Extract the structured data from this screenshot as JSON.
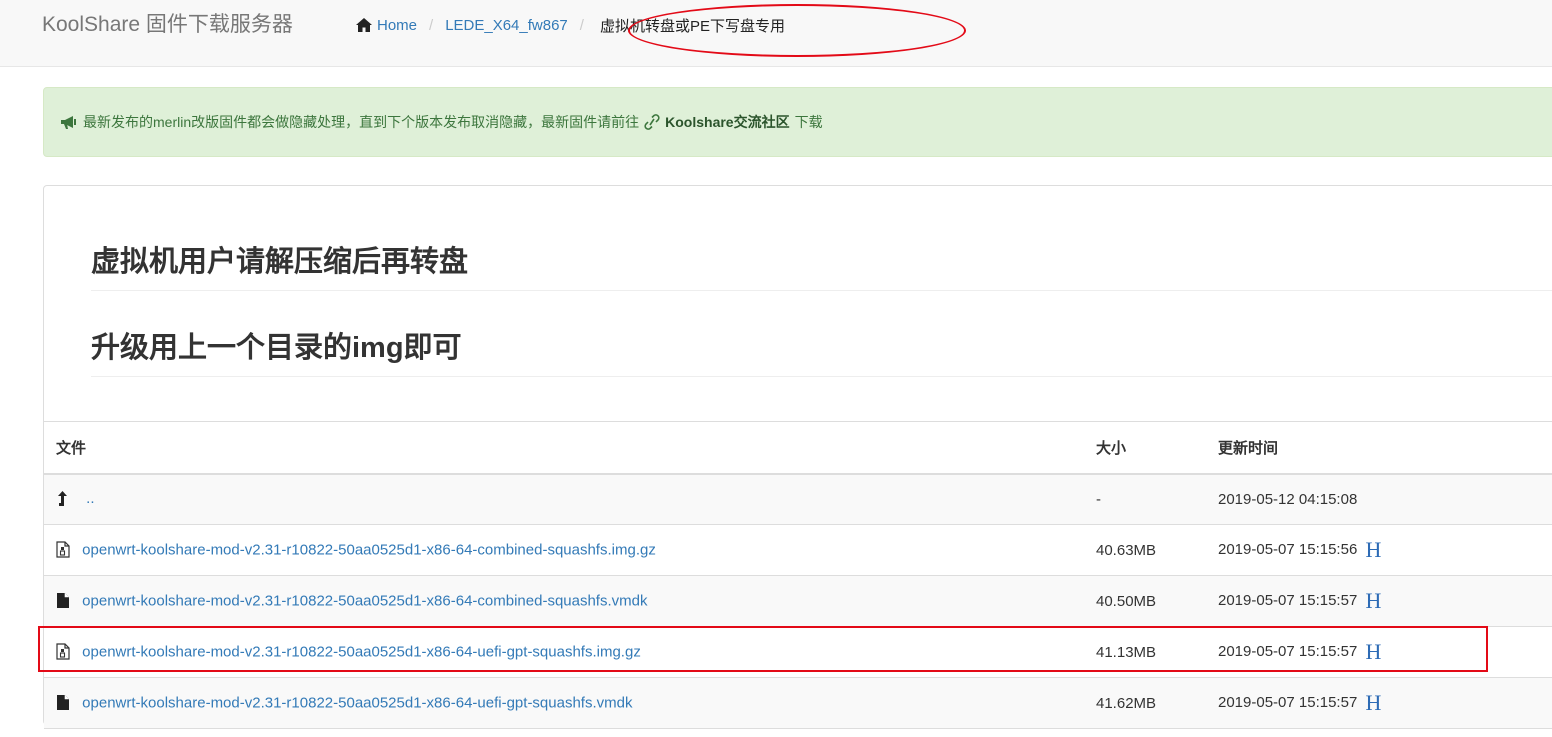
{
  "navbar": {
    "brand": "KoolShare 固件下载服务器",
    "breadcrumb": [
      {
        "label": "Home",
        "icon": "home-icon"
      },
      {
        "label": "LEDE_X64_fw867"
      },
      {
        "label": "虚拟机转盘或PE下写盘专用"
      }
    ]
  },
  "alert": {
    "icon": "megaphone-icon",
    "text": "最新发布的merlin改版固件都会做隐藏处理，直到下个版本发布取消隐藏，最新固件请前往",
    "link_icon": "link-icon",
    "link_label": "Koolshare交流社区",
    "tail": "下载",
    "color": "#3c763d",
    "background": "#dff0d8"
  },
  "headings": [
    "虚拟机用户请解压缩后再转盘",
    "升级用上一个目录的img即可"
  ],
  "table": {
    "columns": [
      "文件",
      "大小",
      "更新时间"
    ],
    "parent_row": {
      "icon": "level-up-icon",
      "label": "..",
      "size": "-",
      "date": "2019-05-12 04:15:08"
    },
    "rows": [
      {
        "icon": "archive-file-icon",
        "name": "openwrt-koolshare-mod-v2.31-r10822-50aa0525d1-x86-64-combined-squashfs.img.gz",
        "size": "40.63MB",
        "date": "2019-05-07 15:15:56",
        "hash": "H"
      },
      {
        "icon": "file-icon",
        "name": "openwrt-koolshare-mod-v2.31-r10822-50aa0525d1-x86-64-combined-squashfs.vmdk",
        "size": "40.50MB",
        "date": "2019-05-07 15:15:57",
        "hash": "H"
      },
      {
        "icon": "archive-file-icon",
        "name": "openwrt-koolshare-mod-v2.31-r10822-50aa0525d1-x86-64-uefi-gpt-squashfs.img.gz",
        "size": "41.13MB",
        "date": "2019-05-07 15:15:57",
        "hash": "H",
        "highlighted": true
      },
      {
        "icon": "file-icon",
        "name": "openwrt-koolshare-mod-v2.31-r10822-50aa0525d1-x86-64-uefi-gpt-squashfs.vmdk",
        "size": "41.62MB",
        "date": "2019-05-07 15:15:57",
        "hash": "H"
      }
    ]
  },
  "annotation_color": "#e30a17",
  "link_color": "#337ab7"
}
